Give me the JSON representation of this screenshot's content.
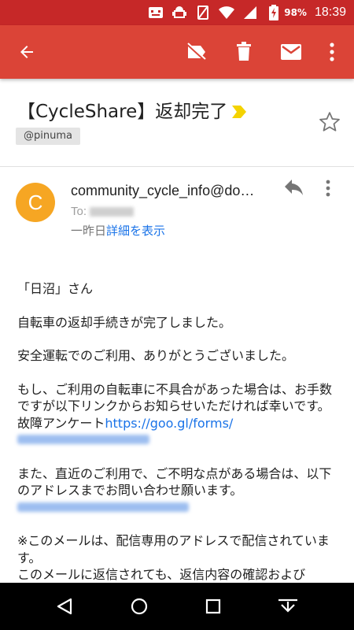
{
  "status_bar": {
    "battery_text": "98%",
    "time": "18:39",
    "icons": [
      "notification-icon",
      "android-icon",
      "signal-off-icon",
      "wifi-icon",
      "cell-signal-icon",
      "battery-charging-icon"
    ]
  },
  "app_bar": {
    "accent_color": "#db4437",
    "actions": [
      "back-arrow-icon",
      "label-off-icon",
      "delete-icon",
      "mark-unread-icon",
      "overflow-menu-icon"
    ]
  },
  "email": {
    "subject": "【CycleShare】返却完了",
    "label": "@pinuma",
    "sender": "community_cycle_info@do…",
    "avatar_letter": "C",
    "to_label": "To:",
    "date": "一昨日",
    "details_link": "詳細を表示",
    "body": {
      "greeting": "「日沼」さん",
      "line1": "自転車の返却手続きが完了しました。",
      "line2": "安全運転でのご利用、ありがとうございました。",
      "line3": "もし、ご利用の自転車に不具合があった場合は、お手数ですが以下リンクからお知らせいただければ幸いです。",
      "survey_label": "故障アンケート",
      "survey_link": "https://goo.gl/forms/",
      "line4": "また、直近のご利用で、ご不明な点がある場合は、以下のアドレスまでお問い合わせ願います。",
      "line5": "※このメールは、配信専用のアドレスで配信されています。",
      "line6": "このメールに返信されても、返信内容の確認および"
    }
  },
  "nav_bar": {
    "buttons": [
      "back-nav-icon",
      "home-nav-icon",
      "recents-nav-icon",
      "hide-keyboard-icon"
    ]
  }
}
